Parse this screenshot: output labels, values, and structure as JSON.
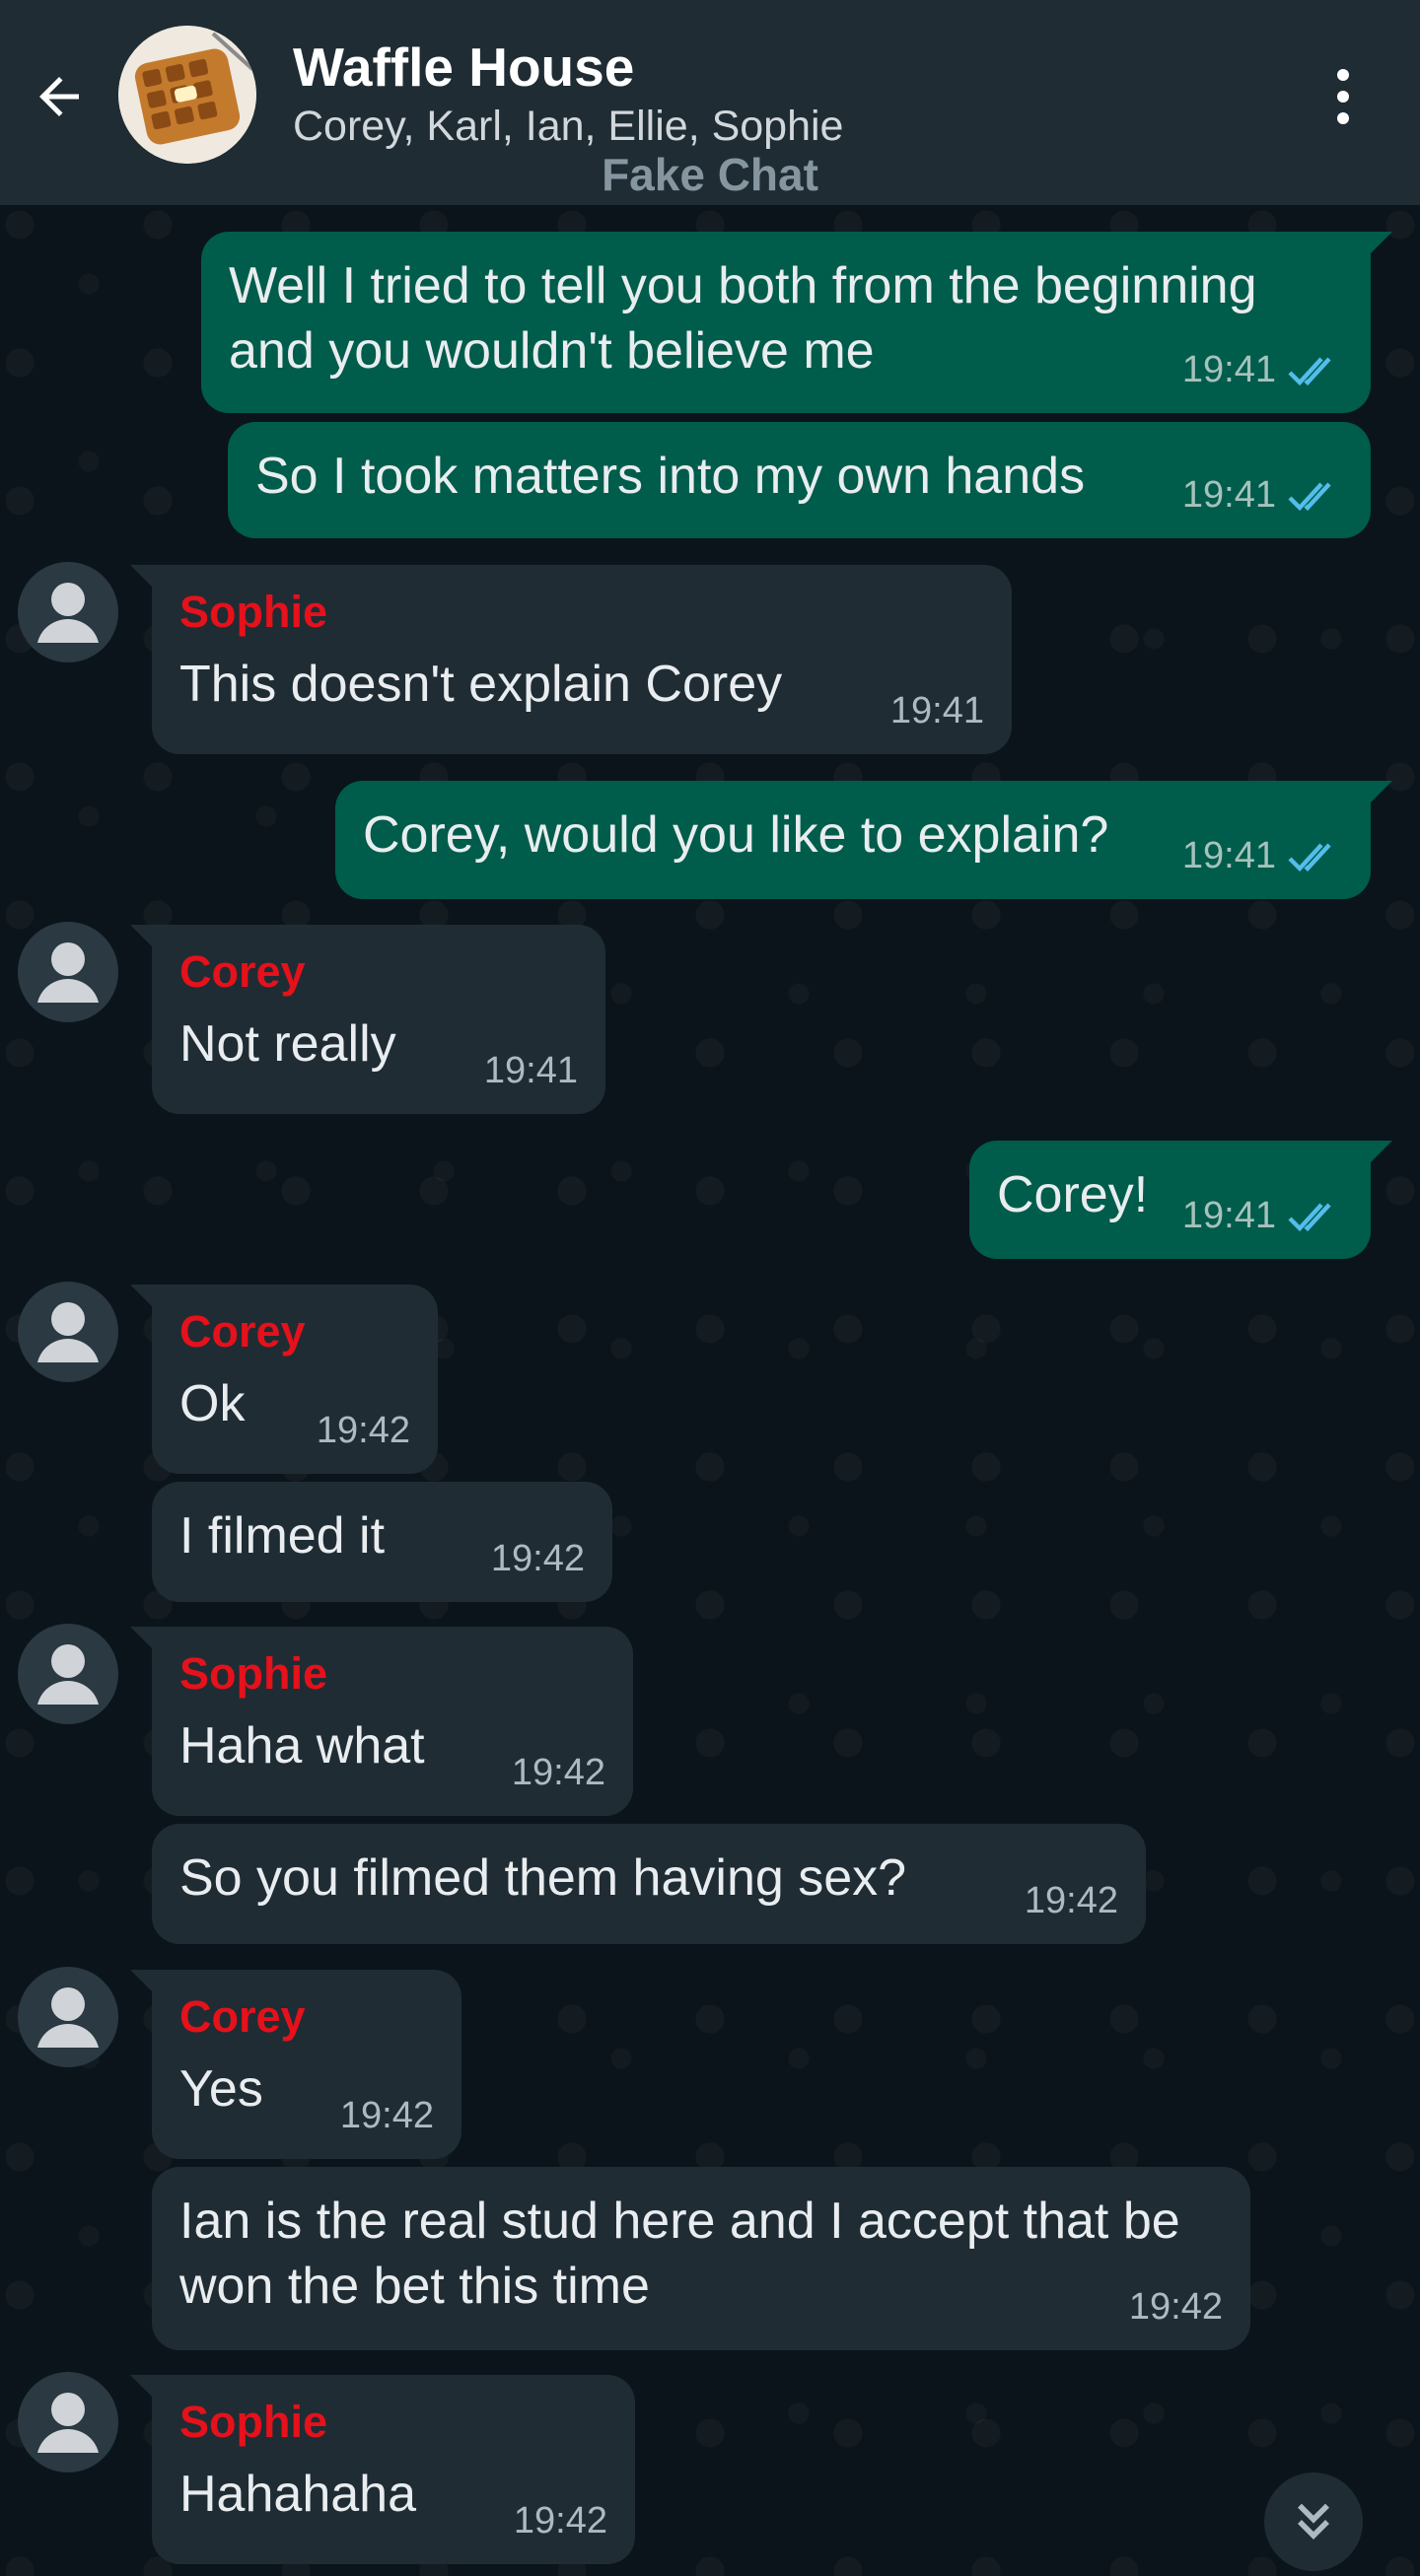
{
  "header": {
    "title": "Waffle House",
    "participants": "Corey, Karl, Ian, Ellie, Sophie",
    "watermark": "Fake Chat",
    "icons": {
      "back": "arrow-left-icon",
      "menu": "more-vertical-icon",
      "group_avatar": "waffle-photo"
    }
  },
  "colors": {
    "outgoing_bubble": "#005c4b",
    "incoming_bubble": "#1f2c34",
    "sender_name": "#e5111b",
    "read_ticks": "#53bdeb",
    "background": "#0b141a"
  },
  "messages": [
    {
      "dir": "out",
      "text": "Well I tried to tell you both from the beginning and you wouldn't believe me",
      "time": "19:41",
      "status": "read"
    },
    {
      "dir": "out",
      "text": "So I took matters into my own hands",
      "time": "19:41",
      "status": "read"
    },
    {
      "dir": "in",
      "sender": "Sophie",
      "text": "This doesn't explain Corey",
      "time": "19:41"
    },
    {
      "dir": "out",
      "text": "Corey, would you like to explain?",
      "time": "19:41",
      "status": "read"
    },
    {
      "dir": "in",
      "sender": "Corey",
      "text": "Not really",
      "time": "19:41"
    },
    {
      "dir": "out",
      "text": "Corey!",
      "time": "19:41",
      "status": "read"
    },
    {
      "dir": "in",
      "sender": "Corey",
      "text": "Ok",
      "time": "19:42"
    },
    {
      "dir": "in",
      "text": "I filmed it",
      "time": "19:42"
    },
    {
      "dir": "in",
      "sender": "Sophie",
      "text": "Haha what",
      "time": "19:42"
    },
    {
      "dir": "in",
      "text": "So you filmed them having sex?",
      "time": "19:42"
    },
    {
      "dir": "in",
      "sender": "Corey",
      "text": "Yes",
      "time": "19:42"
    },
    {
      "dir": "in",
      "text": "Ian is the real stud here and I accept that be won the bet this time",
      "time": "19:42"
    },
    {
      "dir": "in",
      "sender": "Sophie",
      "text": "Hahahaha",
      "time": "19:42"
    }
  ],
  "scroll_button": {
    "icon": "double-chevron-down-icon"
  }
}
